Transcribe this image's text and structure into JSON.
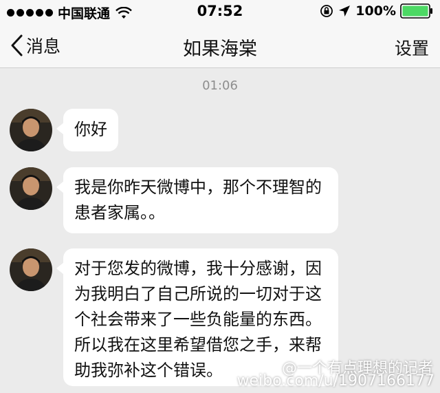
{
  "status_bar": {
    "carrier": "中国联通",
    "time": "07:52",
    "battery": "100%",
    "battery_color": "#4cd964"
  },
  "nav": {
    "back_label": "消息",
    "title": "如果海棠",
    "settings_label": "设置"
  },
  "chat": {
    "timestamp": "01:06",
    "messages": [
      {
        "lines": [
          "你好"
        ]
      },
      {
        "lines": [
          "我是你昨天微博中，那个不理智的",
          "患者家属。。"
        ]
      },
      {
        "lines": [
          "对于您发的微博，我十分感谢，因",
          "为我明白了自己所说的一切对于这",
          "个社会带来了一些负能量的东西。",
          "所以我在这里希望借您之手，来帮",
          "助我弥补这个错误。"
        ]
      }
    ]
  },
  "watermark": {
    "handle": "@一个有点理想的记者",
    "url": "weibo.com/u/1907166177"
  },
  "colors": {
    "chat_background": "#ebebeb",
    "bubble": "#ffffff",
    "bar_background": "#f7f7f7"
  }
}
